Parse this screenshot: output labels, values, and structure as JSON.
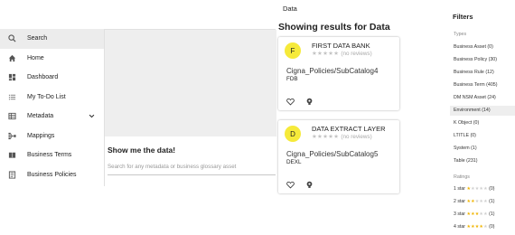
{
  "sidebar": {
    "items": [
      {
        "label": "Search",
        "icon": "search-icon",
        "active": true
      },
      {
        "label": "Home",
        "icon": "home-icon"
      },
      {
        "label": "Dashboard",
        "icon": "dashboard-icon"
      },
      {
        "label": "My To-Do List",
        "icon": "list-icon"
      },
      {
        "label": "Metadata",
        "icon": "table-icon",
        "expandable": true
      },
      {
        "label": "Mappings",
        "icon": "mappings-icon"
      },
      {
        "label": "Business Terms",
        "icon": "book-icon"
      },
      {
        "label": "Business Policies",
        "icon": "policy-icon"
      }
    ]
  },
  "middle": {
    "title": "Show me the data!",
    "search_placeholder": "Search for any metadata or business glossary asset"
  },
  "results": {
    "label": "Data",
    "title": "Showing results for Data",
    "cards": [
      {
        "initial": "F",
        "name": "FIRST DATA BANK",
        "stars": "★★★★★",
        "reviews": "(no reviews)",
        "path": "Cigna_Policies/SubCatalog4",
        "code": "FDB"
      },
      {
        "initial": "D",
        "name": "DATA EXTRACT LAYER",
        "stars": "★★★★★",
        "reviews": "(no reviews)",
        "path": "Cigna_Policies/SubCatalog5",
        "code": "DEXL"
      }
    ]
  },
  "filters": {
    "title": "Filters",
    "types_label": "Types",
    "types": [
      "Business Asset (0)",
      "Business Policy (30)",
      "Business Rule (12)",
      "Business Term (405)",
      "DM NSM Asset (24)",
      "Environment (14)",
      "K Object (0)",
      "LTITLE (0)",
      "System (1)",
      "Table (231)"
    ],
    "highlighted_index": 5,
    "ratings_label": "Ratings",
    "ratings": [
      {
        "label": "1 star",
        "count": "(0)",
        "filled": 1
      },
      {
        "label": "2 star",
        "count": "(1)",
        "filled": 2
      },
      {
        "label": "3 star",
        "count": "(1)",
        "filled": 3
      },
      {
        "label": "4 star",
        "count": "(0)",
        "filled": 4
      }
    ],
    "star_color": "#f0b400"
  },
  "colors": {
    "avatar": "#f6ea3a",
    "active_nav": "#ececec",
    "banner": "#eeeeee"
  }
}
